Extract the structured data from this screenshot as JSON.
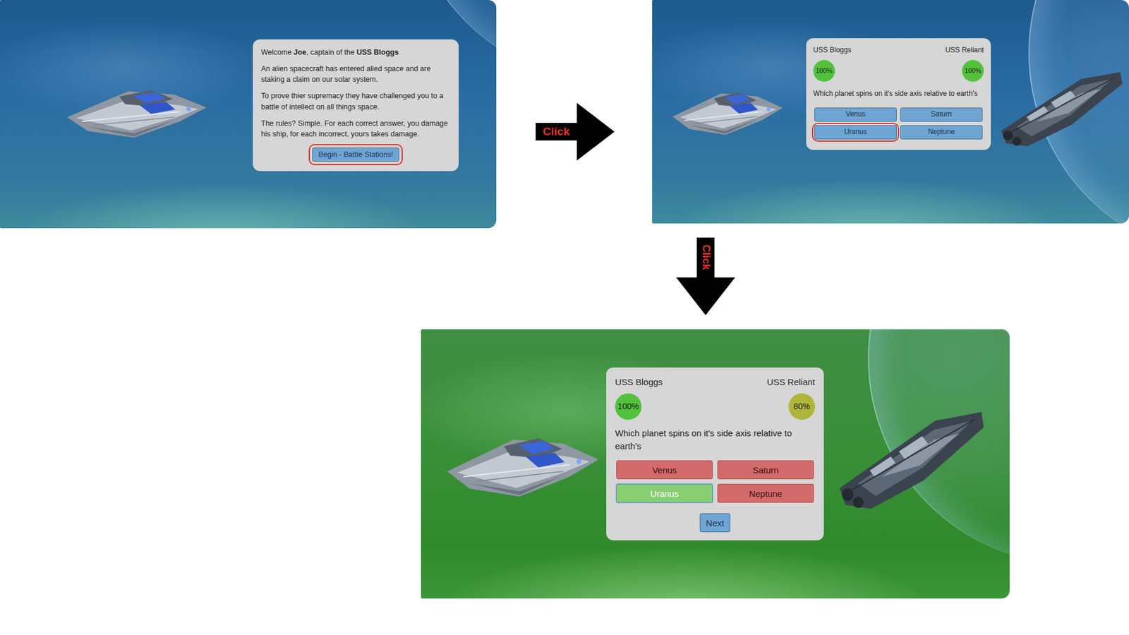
{
  "screens": [
    {
      "kind": "intro",
      "outcome": "none",
      "welcome": [
        {
          "text": "Welcome ",
          "bold": false
        },
        {
          "text": "Joe",
          "bold": true
        },
        {
          "text": ", captain of the ",
          "bold": false
        },
        {
          "text": "USS Bloggs",
          "bold": true
        }
      ],
      "paragraphs": [
        "An alien spacecraft has entered alied space and are staking a claim on our solar system.",
        "To prove thier supremacy they have challenged you to a battle of intellect on all things space.",
        "The rules? Simple. For each correct answer, you damage his ship, for each incorrect, yours takes damage."
      ],
      "button": {
        "label": "Begin - Battle Stations!",
        "highlighted": true
      }
    },
    {
      "kind": "question",
      "outcome": "none",
      "players": [
        {
          "name": "USS Bloggs",
          "health": "100%",
          "color": "#52c23c"
        },
        {
          "name": "USS Reliant",
          "health": "100%",
          "color": "#52c23c"
        }
      ],
      "question": "Which planet spins on it's side axis relative to earth's",
      "answers": [
        {
          "label": "Venus",
          "highlighted": false,
          "result": "none"
        },
        {
          "label": "Saturn",
          "highlighted": false,
          "result": "none"
        },
        {
          "label": "Uranus",
          "highlighted": true,
          "result": "none"
        },
        {
          "label": "Neptune",
          "highlighted": false,
          "result": "none"
        }
      ]
    },
    {
      "kind": "question",
      "outcome": "correct",
      "players": [
        {
          "name": "USS Bloggs",
          "health": "100%",
          "color": "#52c23c"
        },
        {
          "name": "USS Reliant",
          "health": "80%",
          "color": "#b0b43a"
        }
      ],
      "question": "Which planet spins on it's side axis relative to earth's",
      "answers": [
        {
          "label": "Venus",
          "highlighted": false,
          "result": "incorrect"
        },
        {
          "label": "Saturn",
          "highlighted": false,
          "result": "incorrect"
        },
        {
          "label": "Uranus",
          "highlighted": false,
          "result": "correct"
        },
        {
          "label": "Neptune",
          "highlighted": false,
          "result": "incorrect"
        }
      ],
      "next": "Next"
    }
  ],
  "arrows": [
    {
      "label": "Click",
      "direction": "right"
    },
    {
      "label": "Click",
      "direction": "down"
    }
  ]
}
